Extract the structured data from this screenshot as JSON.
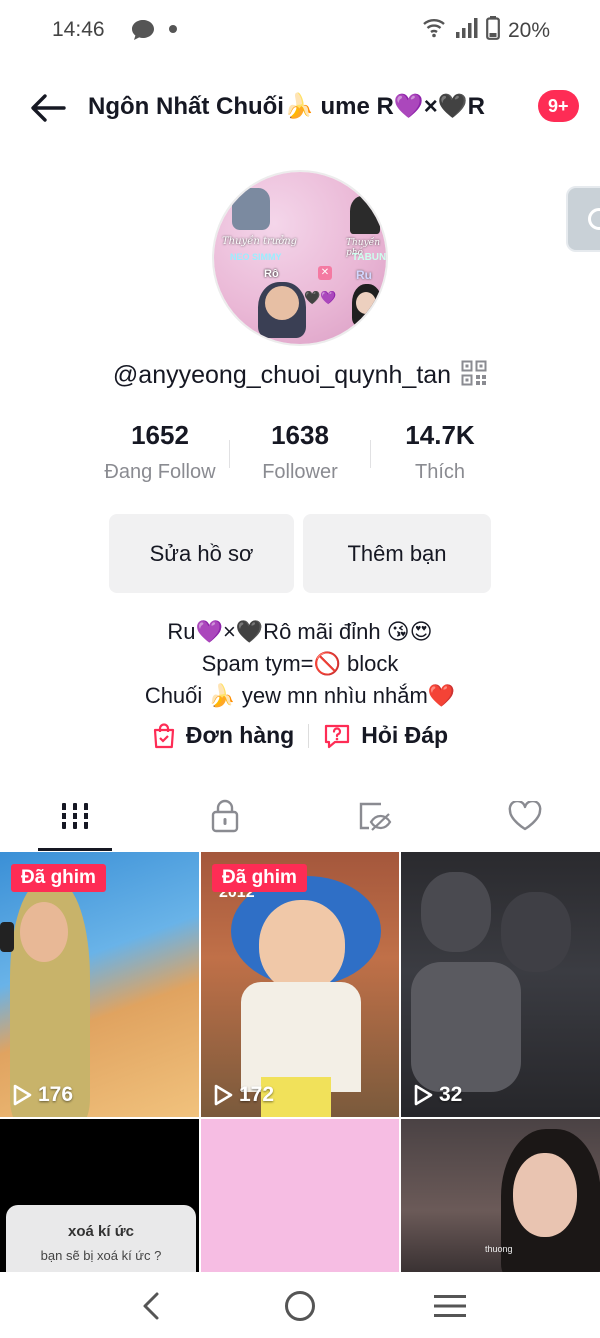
{
  "status_bar": {
    "time": "14:46",
    "battery": "20%"
  },
  "header": {
    "title": "Ngôn Nhất Chuối🍌 ume R💜×🖤R",
    "badge": "9+"
  },
  "profile": {
    "avatar_texts": [
      "Thuyền trưởng",
      "NEO SIMMY",
      "Thuyền phó",
      "TABUN",
      "Rô",
      "Ru"
    ],
    "username": "@anyyeong_chuoi_quynh_tan",
    "stats": [
      {
        "value": "1652",
        "label": "Đang Follow"
      },
      {
        "value": "1638",
        "label": "Follower"
      },
      {
        "value": "14.7K",
        "label": "Thích"
      }
    ],
    "edit_button": "Sửa hồ sơ",
    "add_friend_button": "Thêm bạn",
    "bio": [
      "Ru💜×🖤Rô mãi đỉnh 😘😍",
      "Spam tym=🚫 block",
      "Chuối 🍌 yew mn nhìu nhắm❤️"
    ],
    "links": {
      "orders": "Đơn hàng",
      "qa": "Hỏi Đáp"
    }
  },
  "tabs": [
    "videos-icon",
    "lock-icon",
    "hidden-icon",
    "heart-icon"
  ],
  "videos": [
    {
      "pinned": "Đã ghim",
      "views": "176"
    },
    {
      "pinned": "Đã ghim",
      "views": "172",
      "overlay": "2012"
    },
    {
      "views": "32"
    },
    {
      "popup_title": "xoá kí ức",
      "popup_text": "bạn sẽ bị xoá kí ức ?"
    },
    {},
    {
      "caption": "thuong"
    }
  ],
  "colors": {
    "accent": "#fe2c55",
    "text": "#161823",
    "muted": "#8a8b91"
  }
}
